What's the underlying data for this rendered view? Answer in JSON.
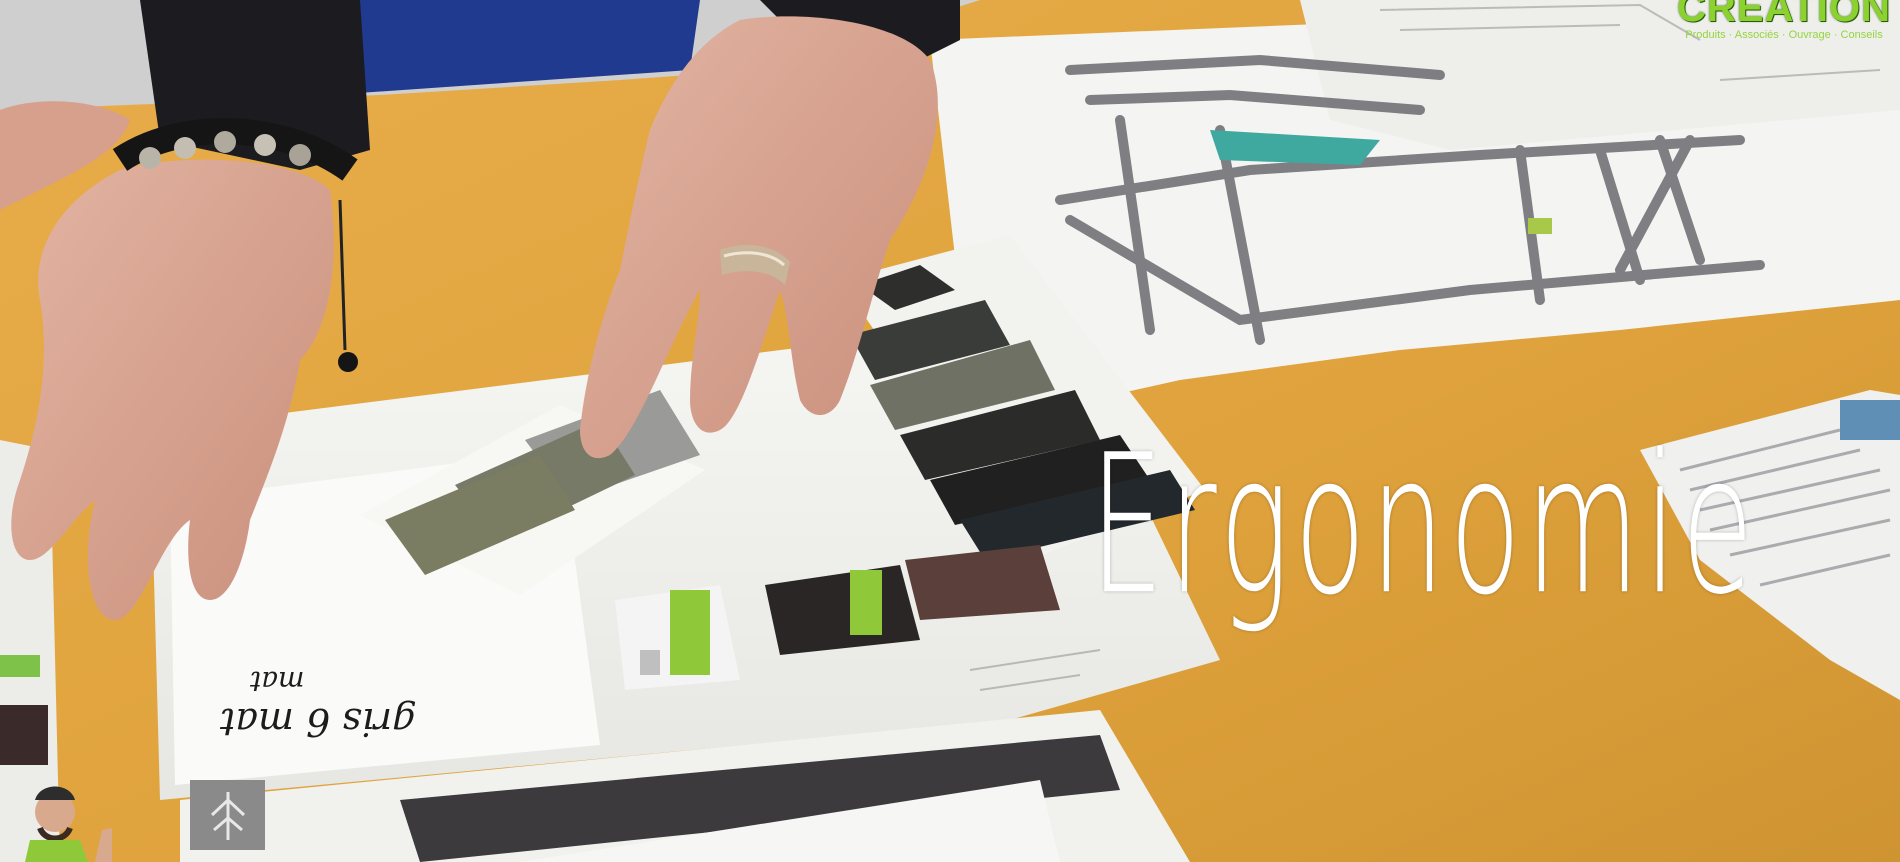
{
  "caption": {
    "text": "Ergonomie",
    "color": "#ffffff"
  },
  "logo": {
    "title": "CREATION",
    "tagline": "Produits · Associés · Ouvrage · Conseils",
    "color": "#8bd22f"
  },
  "handwritten_note": {
    "line1": "gris 6 mat",
    "line2": "mat"
  },
  "colors": {
    "table": "#e0a640",
    "paper": "#f2f2ef",
    "skin": "#d9a996",
    "sleeve_dark": "#1b1b20",
    "sleeve_blue": "#1f3a8f",
    "swatch_olive": "#7f8170",
    "swatch_dark": "#2e2f2c",
    "accent_green": "#8fc93a",
    "accent_teal": "#3fa9a0"
  },
  "icons": {
    "mascot": "mascot-icon",
    "leaf_logo": "leaf-logo-icon",
    "bracelet": "bead-bracelet"
  }
}
